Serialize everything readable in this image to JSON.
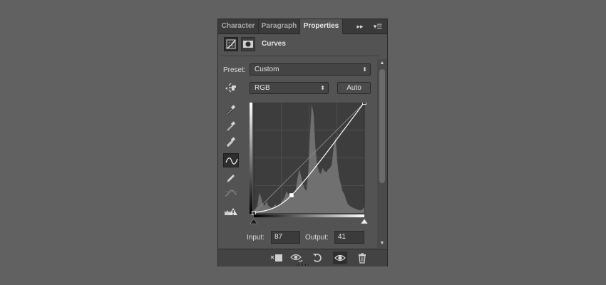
{
  "tabs": [
    {
      "label": "Character"
    },
    {
      "label": "Paragraph"
    },
    {
      "label": "Properties"
    }
  ],
  "tab_controls": {
    "collapse": "▸▸",
    "menu": "▾☰"
  },
  "header": {
    "title": "Curves"
  },
  "preset": {
    "label": "Preset:",
    "value": "Custom"
  },
  "channel": {
    "value": "RGB"
  },
  "auto_button": {
    "label": "Auto"
  },
  "input": {
    "label": "Input:",
    "value": "87"
  },
  "output": {
    "label": "Output:",
    "value": "41"
  },
  "curve": {
    "points": [
      [
        0,
        0
      ],
      [
        87,
        41
      ],
      [
        255,
        255
      ]
    ]
  },
  "histogram": {
    "values": [
      4,
      6,
      10,
      28,
      22,
      12,
      10,
      16,
      10,
      8,
      7,
      9,
      12,
      8,
      10,
      14,
      18,
      22,
      30,
      26,
      22,
      20,
      24,
      30,
      46,
      60,
      52,
      40,
      34,
      30,
      52,
      108,
      150,
      136,
      90,
      66,
      56,
      54,
      62,
      58,
      56,
      60,
      62,
      66,
      90,
      104,
      72,
      50,
      40,
      30,
      26,
      18,
      12,
      10,
      8,
      7,
      6,
      5,
      4,
      4,
      5,
      8
    ]
  },
  "colors": {
    "background": "#616161",
    "panel": "#535353",
    "graph_bg": "#3d3d3d",
    "histogram": "#707070"
  }
}
